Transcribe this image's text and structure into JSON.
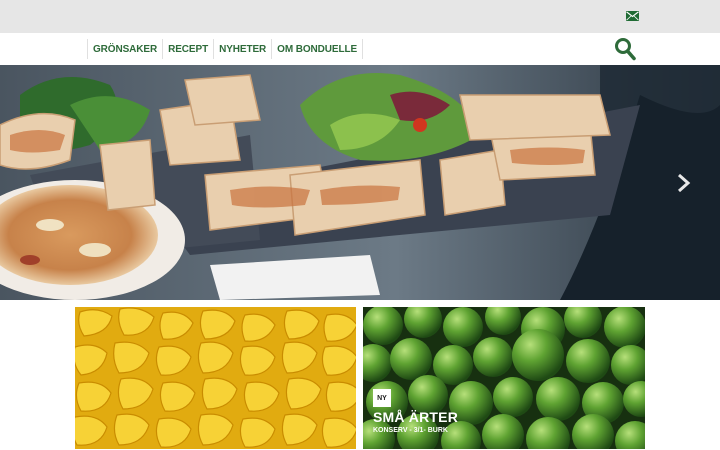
{
  "nav": {
    "items": [
      {
        "label": "GRÖNSAKER"
      },
      {
        "label": "RECEPT"
      },
      {
        "label": "NYHETER"
      },
      {
        "label": "OM BONDUELLE"
      }
    ]
  },
  "icons": {
    "mail": "mail-icon",
    "search": "search-icon",
    "next": "chevron-right-icon"
  },
  "colors": {
    "brand_green": "#2e6b3a",
    "topbar": "#e6e6e6"
  },
  "product": {
    "badge": "NY",
    "title": "SMÅ ÄRTER",
    "subtitle": "KONSERV - 3/1- BURK"
  }
}
